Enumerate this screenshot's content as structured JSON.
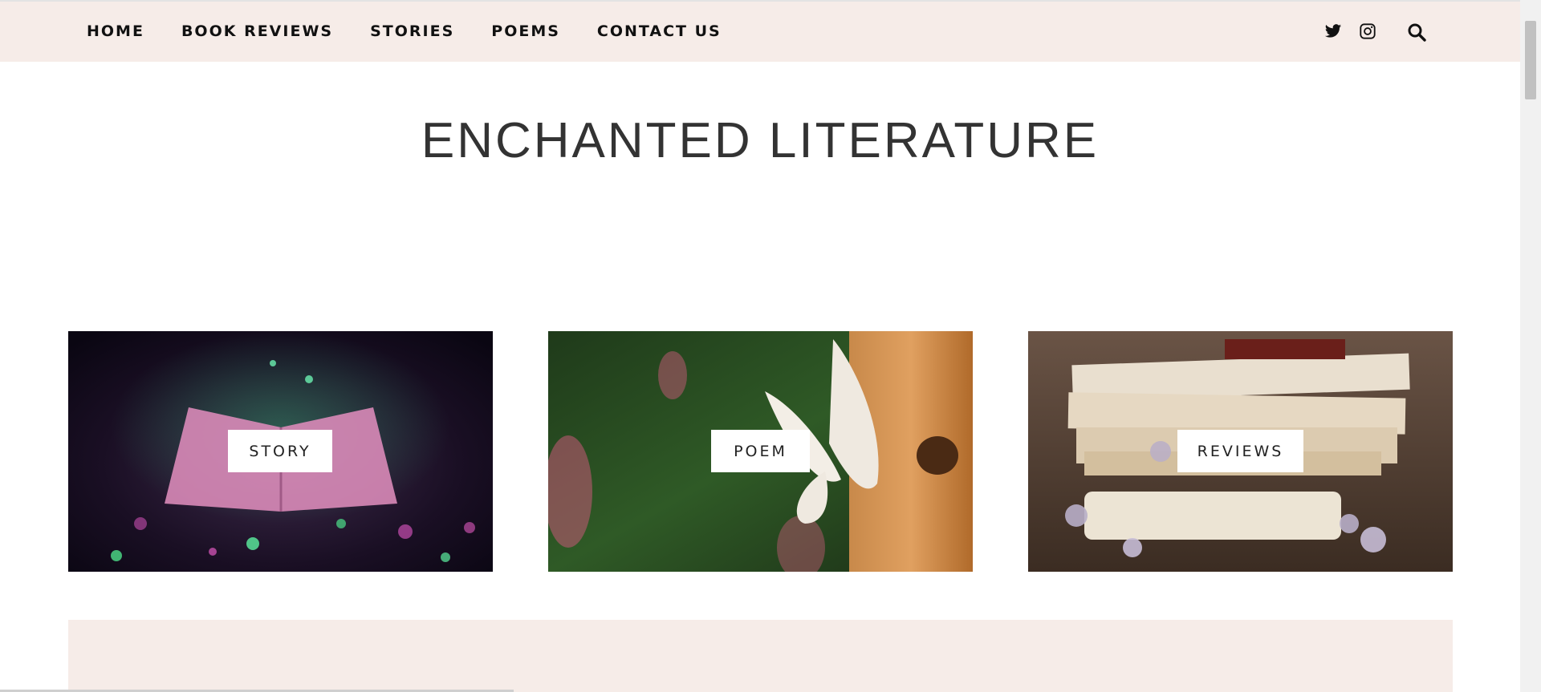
{
  "nav": {
    "items": [
      {
        "label": "HOME"
      },
      {
        "label": "BOOK REVIEWS"
      },
      {
        "label": "STORIES"
      },
      {
        "label": "POEMS"
      },
      {
        "label": "CONTACT US"
      }
    ]
  },
  "social": {
    "icons": [
      "twitter-icon",
      "instagram-icon",
      "search-icon"
    ]
  },
  "site": {
    "title": "ENCHANTED LITERATURE"
  },
  "tiles": [
    {
      "label": "STORY"
    },
    {
      "label": "POEM"
    },
    {
      "label": "REVIEWS"
    }
  ],
  "colors": {
    "header_bg": "#f6ece8",
    "band_bg": "#f6ece8",
    "text": "#111111"
  }
}
